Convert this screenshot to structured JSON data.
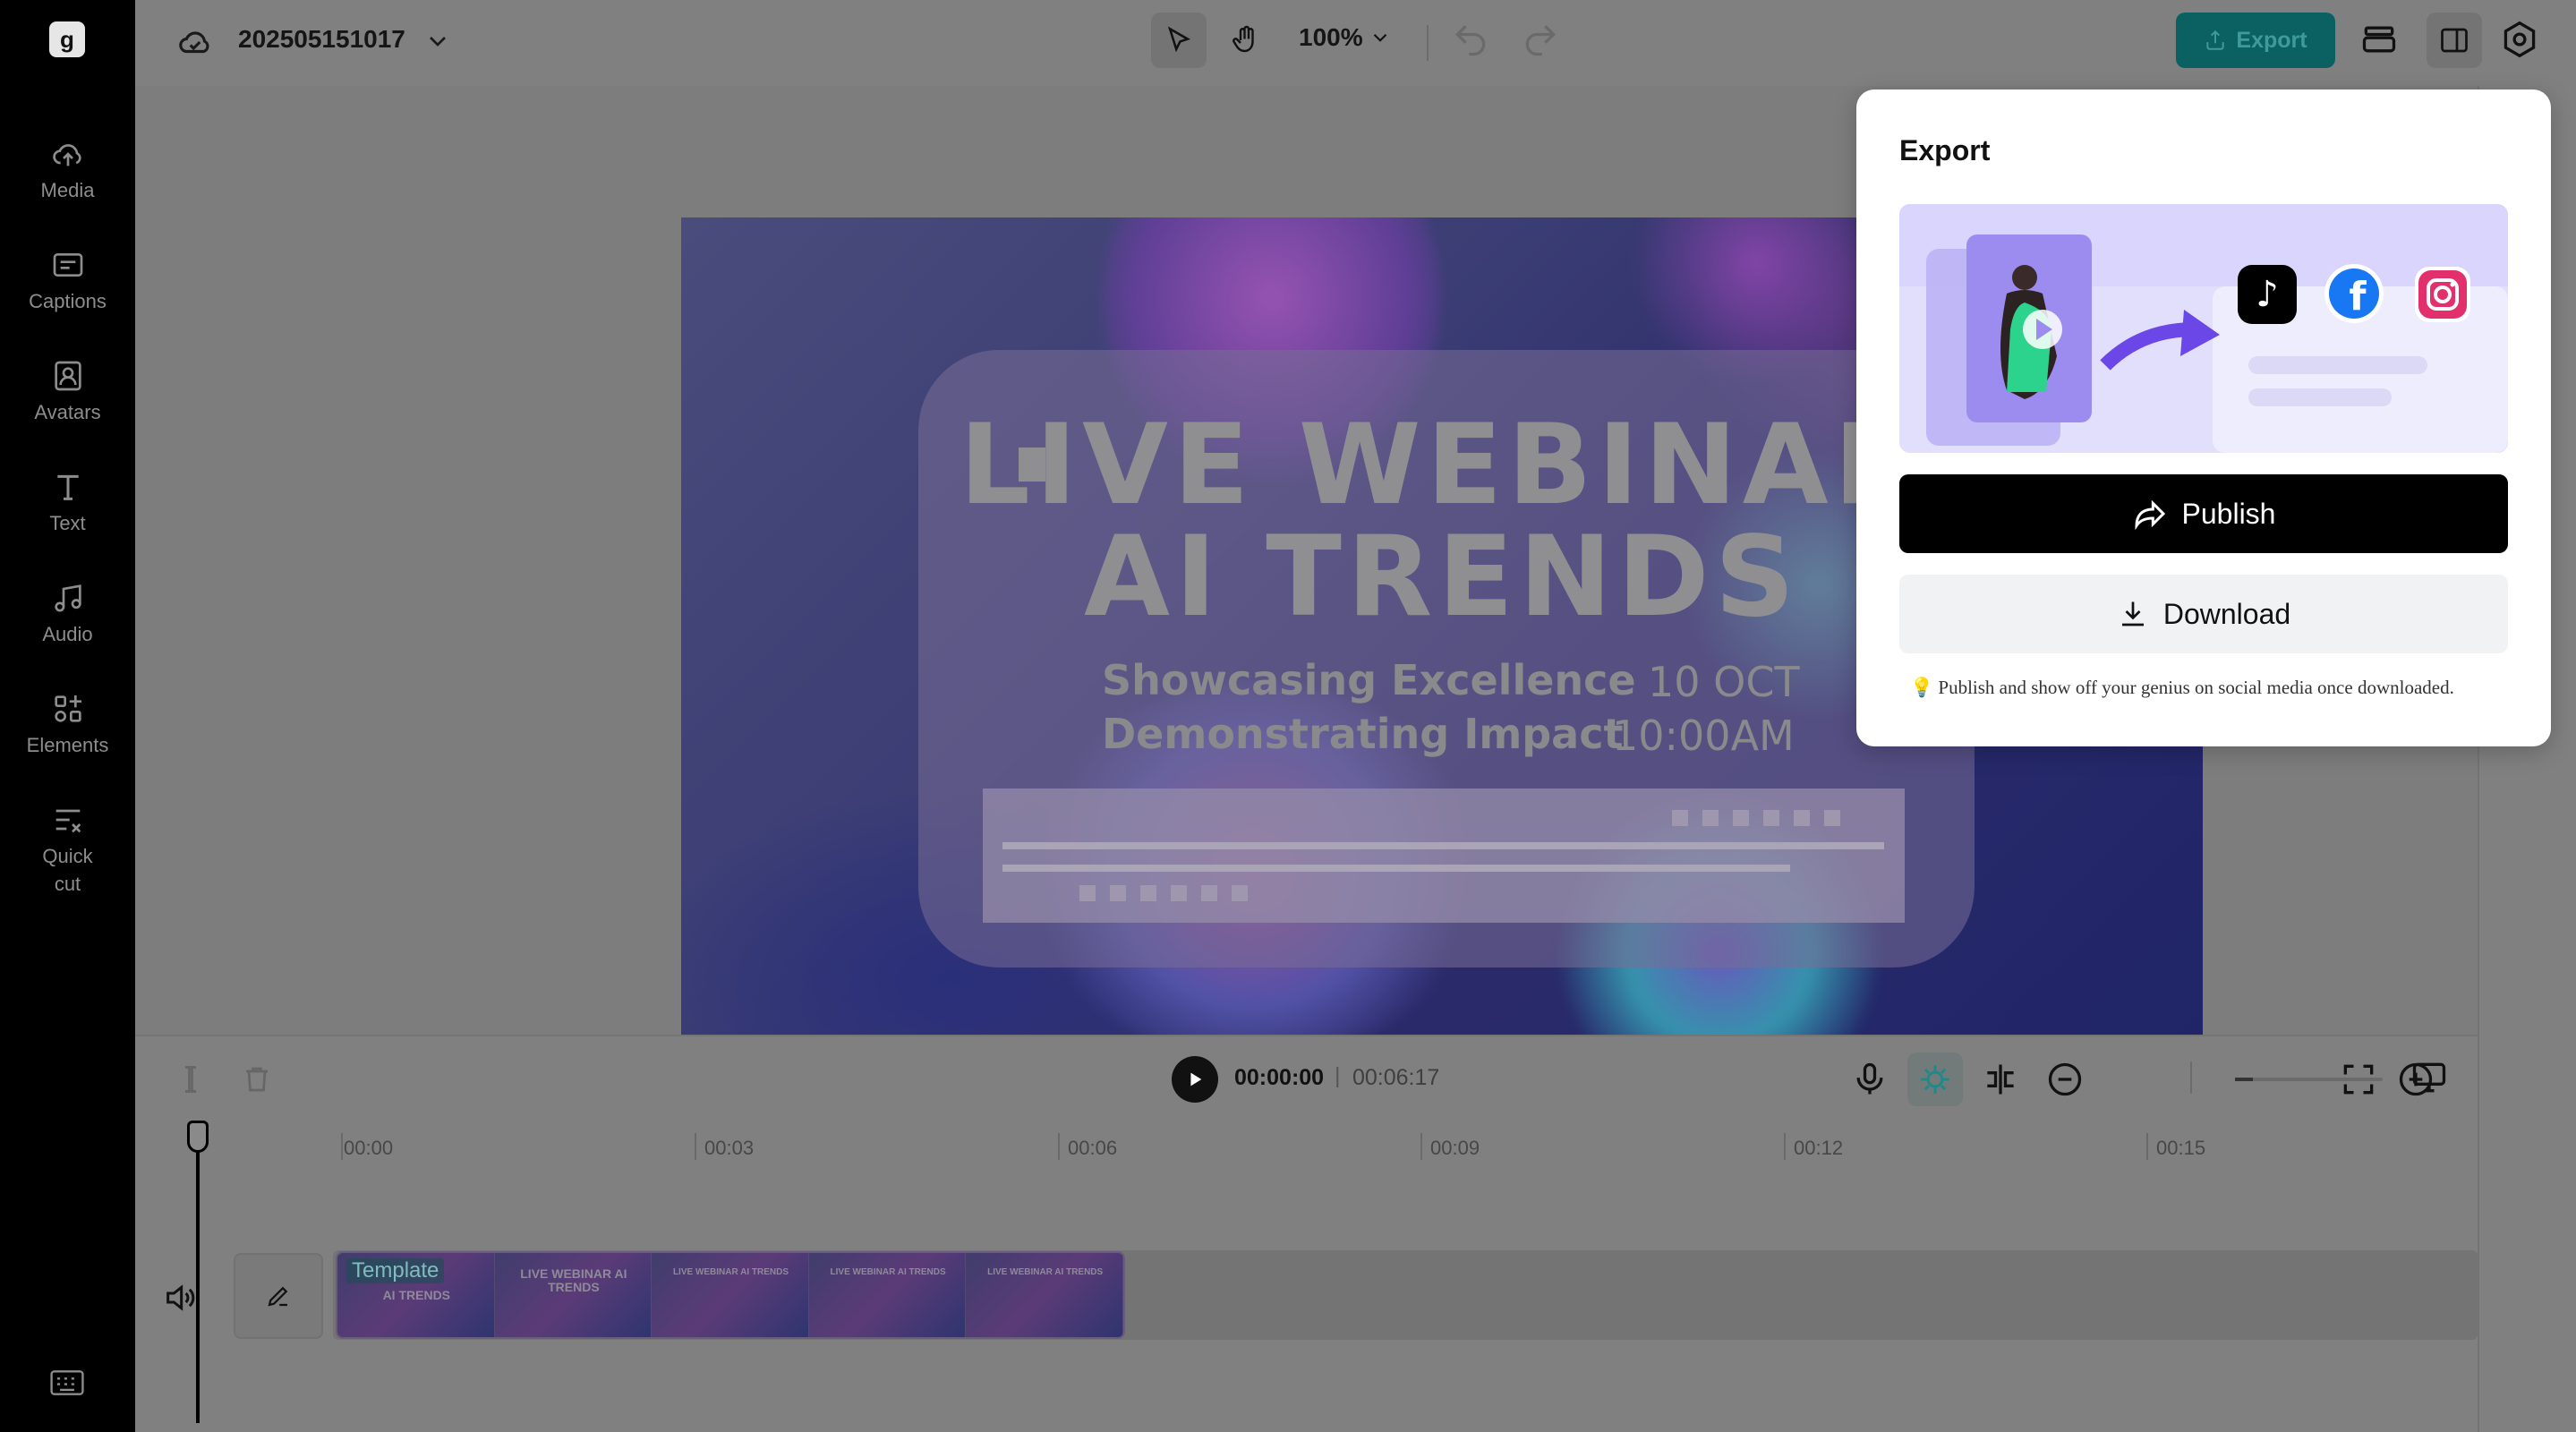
{
  "app": {
    "project_name": "202505151017",
    "zoom": "100%",
    "export_label": "Export",
    "colors": {
      "accent": "#0b6162",
      "overlay": "#7d7d7d",
      "publish_bg": "#000000",
      "download_bg": "#f1f2f4"
    }
  },
  "sidebar": {
    "items": [
      {
        "label": "Media",
        "icon": "cloud-upload-icon"
      },
      {
        "label": "Captions",
        "icon": "captions-icon"
      },
      {
        "label": "Avatars",
        "icon": "avatar-icon"
      },
      {
        "label": "Text",
        "icon": "text-icon"
      },
      {
        "label": "Audio",
        "icon": "music-note-icon"
      },
      {
        "label": "Elements",
        "icon": "elements-icon"
      },
      {
        "label": "Quick cut",
        "icon": "quick-cut-icon"
      }
    ]
  },
  "preview": {
    "title_line1": "LIVE WEBINAR",
    "title_line2": "AI TRENDS",
    "subtitle_line1": "Showcasing Excellence",
    "subtitle_line2": "Demonstrating Impact",
    "date": "10 OCT",
    "time": "10:00AM"
  },
  "timeline": {
    "current_time": "00:00:00",
    "separator": "|",
    "total_time": "00:06:17",
    "ruler": [
      "00:00",
      "00:03",
      "00:06",
      "00:09",
      "00:12",
      "00:15"
    ],
    "clip_badge": "Template",
    "clip_frames": [
      "AI TRENDS",
      "LIVE WEBINAR AI TRENDS",
      "LIVE WEBINAR AI TRENDS",
      "LIVE WEBINAR AI TRENDS",
      "LIVE WEBINAR AI TRENDS"
    ]
  },
  "export_popover": {
    "title": "Export",
    "publish_label": "Publish",
    "download_label": "Download",
    "hint": "💡 Publish and show off your genius on social media once downloaded.",
    "social_icons": [
      "tiktok-icon",
      "facebook-icon",
      "instagram-icon"
    ]
  }
}
